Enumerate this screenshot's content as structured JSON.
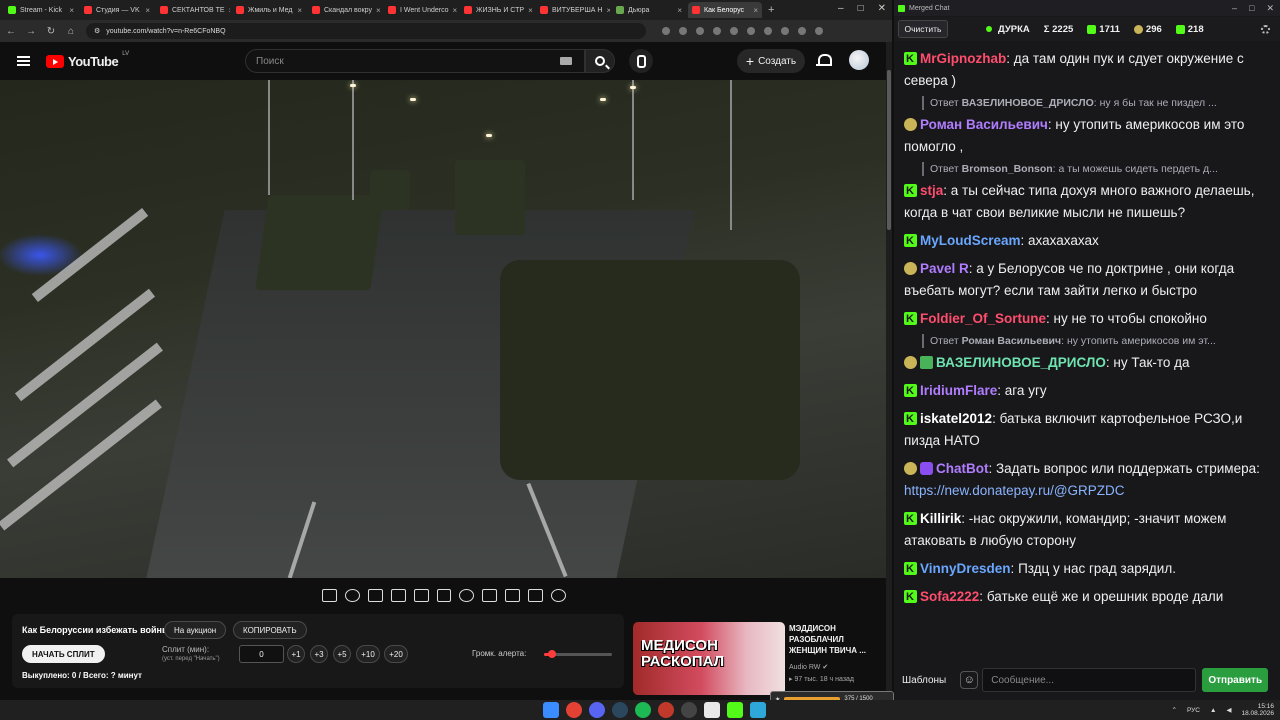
{
  "browser": {
    "tabs": [
      {
        "label": "Stream - Kick",
        "fav": "#53fc18"
      },
      {
        "label": "Студия — VK",
        "fav": "#ff3333"
      },
      {
        "label": "СЕКТАНТОВ ТЕ",
        "fav": "#ff3333"
      },
      {
        "label": "Жмиль и Мед",
        "fav": "#ff3333"
      },
      {
        "label": "Скандал вокру",
        "fav": "#ff3333"
      },
      {
        "label": "I Went Underco",
        "fav": "#ff3333"
      },
      {
        "label": "ЖИЗНЬ И СТР",
        "fav": "#ff3333"
      },
      {
        "label": "ВИТУБЕРША Н",
        "fav": "#ff3333"
      },
      {
        "label": "Дьюра",
        "fav": "#6aa84f"
      },
      {
        "label": "Как Белорус",
        "fav": "#ff3333",
        "active": true
      }
    ],
    "url": "youtube.com/watch?v=n-Re6CFoNBQ"
  },
  "youtube": {
    "logo_text": "YouTube",
    "country": "LV",
    "search_placeholder": "Поиск",
    "create_label": "Создать"
  },
  "auction": {
    "title": "Как Белоруссии избежать войны",
    "to_auction": "На аукцион",
    "copy": "КОПИРОВАТЬ",
    "start_split": "НАЧАТЬ СПЛИТ",
    "split_label": "Сплит (мин):",
    "split_hint": "(уст. перед \"Начать\")",
    "split_value": "0",
    "increments": [
      "+1",
      "+3",
      "+5",
      "+10",
      "+20"
    ],
    "redeemed": "Выкуплено: 0 / Всего: ? минут",
    "volume_label": "Громк. алерта:",
    "volume_level": 0.12
  },
  "recommended": {
    "thumb_text_1": "МЕДИСОН",
    "thumb_text_2": "РАСКОПАЛ",
    "title": "МЭДДИСОН РАЗОБЛАЧИЛ ЖЕНЩИН ТВИЧА ...",
    "channel": "Audio RW",
    "meta": "97 тыс.   18 ч назад"
  },
  "mini_widget": {
    "label": "375 / 1500"
  },
  "chat": {
    "window_title": "Merged Chat",
    "clear": "Очистить",
    "channel": "ДУРКА",
    "stats": [
      "Σ 2225",
      "1711",
      "296",
      "218"
    ],
    "input_placeholder": "Сообщение...",
    "templates": "Шаблоны",
    "send": "Отправить",
    "messages": [
      {
        "badge": "kick",
        "user": "MrGipnozhab",
        "color": "#ff4d6d",
        "text": "да там один пук и сдует окружение с севера )"
      },
      {
        "reply_user": "ВАЗЕЛИНОВОЕ_ДРИСЛО",
        "reply_text": "ну я бы так не пиздел ..."
      },
      {
        "badge": "gold",
        "user": "Роман Васильевич",
        "color": "#b07dff",
        "text": "ну утопить америкосов им это помогло ,"
      },
      {
        "reply_user": "Bromson_Bonson",
        "reply_text": "а ты можешь сидеть пердеть д..."
      },
      {
        "badge": "kick",
        "user": "stja",
        "color": "#ff4d6d",
        "text": "а ты сейчас типа дохуя много важного делаешь, когда в чат свои великие мысли не пишешь?"
      },
      {
        "badge": "kick",
        "user": "MyLoudScream",
        "color": "#6aa7ff",
        "text": "ахахахахах"
      },
      {
        "badge": "gold",
        "user": "Pavel R",
        "color": "#b07dff",
        "text": "а у Белорусов че по доктрине , они когда въебать могут? если там зайти легко и быстро"
      },
      {
        "badge": "kick",
        "user": "Foldier_Of_Sortune",
        "color": "#ff4d6d",
        "text": "ну не то чтобы спокойно"
      },
      {
        "reply_user": "Роман Васильевич",
        "reply_text": "ну утопить америкосов им эт..."
      },
      {
        "badge": "gold",
        "badge2": "edit",
        "user": "ВАЗЕЛИНОВОЕ_ДРИСЛО",
        "color": "#6fe3b0",
        "text": "ну Так-то да"
      },
      {
        "badge": "kick",
        "user": "IridiumFlare",
        "color": "#b07dff",
        "text": "ага угу"
      },
      {
        "badge": "kick",
        "user": "iskatel2012",
        "color": "#ffffff",
        "text": "батька включит картофельное РСЗО,и пизда НАТО"
      },
      {
        "badge": "gold",
        "badge2": "bot",
        "user": "ChatBot",
        "color": "#b07dff",
        "text": "Задать вопрос или поддержать стримера: ",
        "link": "https://new.donatepay.ru/@GRPZDC"
      },
      {
        "badge": "kick",
        "user": "Killirik",
        "color": "#ffffff",
        "text": "-нас окружили, командир; -значит можем атаковать в любую сторону"
      },
      {
        "badge": "kick",
        "user": "VinnyDresden",
        "color": "#6aa7ff",
        "text": "Пздц у нас град зарядил."
      },
      {
        "badge": "kick",
        "user": "Sofa2222",
        "color": "#ff4d6d",
        "text": "батьке ещё же и орешник вроде дали"
      }
    ]
  },
  "taskbar": {
    "lang": "РУС",
    "time": "15:16",
    "date": "18.08.2026"
  }
}
